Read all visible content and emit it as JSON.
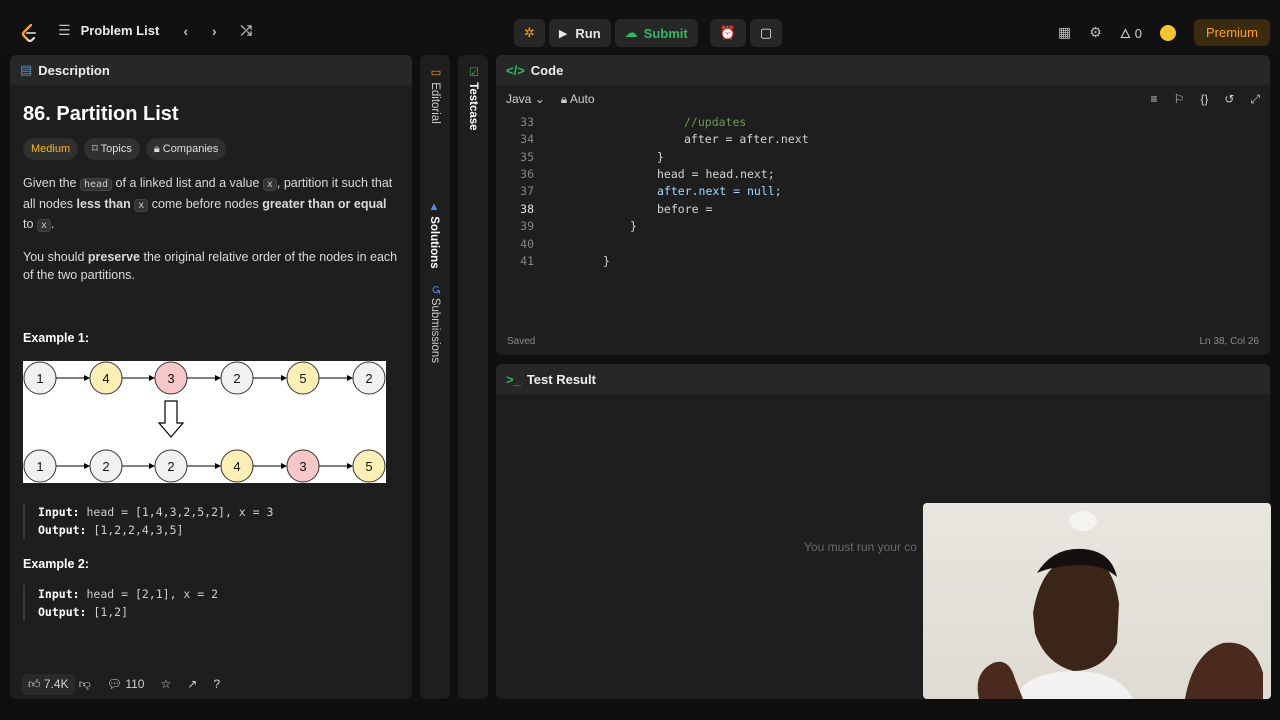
{
  "topbar": {
    "problem_list_label": "Problem List",
    "run_label": "Run",
    "submit_label": "Submit",
    "streak_count": "0",
    "premium_label": "Premium"
  },
  "description": {
    "header_label": "Description",
    "title": "86. Partition List",
    "chips": {
      "difficulty": "Medium",
      "topics": "Topics",
      "companies": "Companies"
    },
    "para1": {
      "t1": "Given the ",
      "c1": "head",
      "t2": " of a linked list and a value ",
      "c2": "x",
      "t3": ", partition it such that all nodes ",
      "b1": "less than",
      "t4": " ",
      "c3": "x",
      "t5": " come before nodes ",
      "b2": "greater than or equal",
      "t6": " to ",
      "c4": "x",
      "t7": "."
    },
    "para2": {
      "t1": "You should ",
      "b1": "preserve",
      "t2": " the original relative order of the nodes in each of the two partitions."
    },
    "example1": {
      "title": "Example 1:",
      "input_key": "Input:",
      "input_val": "head = [1,4,3,2,5,2], x = 3",
      "output_key": "Output:",
      "output_val": "[1,2,2,4,3,5]",
      "top_nodes": [
        "1",
        "4",
        "3",
        "2",
        "5",
        "2"
      ],
      "bottom_nodes": [
        "1",
        "2",
        "2",
        "4",
        "3",
        "5"
      ]
    },
    "example2": {
      "title": "Example 2:",
      "input_key": "Input:",
      "input_val": "head = [2,1], x = 2",
      "output_key": "Output:",
      "output_val": "[1,2]"
    },
    "footer": {
      "likes": "7.4K",
      "comments": "110"
    }
  },
  "side_tabs": {
    "editorial": "Editorial",
    "solutions": "Solutions",
    "submissions": "Submissions",
    "testcase": "Testcase"
  },
  "code": {
    "header_label": "Code",
    "language": "Java",
    "mode": "Auto",
    "lines": [
      {
        "n": "33",
        "text": "//updates"
      },
      {
        "n": "34",
        "text": "after = after.next"
      },
      {
        "n": "35",
        "text": "}"
      },
      {
        "n": "36",
        "text": "head = head.next;"
      },
      {
        "n": "37",
        "text": "after.next = null;"
      },
      {
        "n": "38",
        "text": "before = "
      },
      {
        "n": "39",
        "text": "}"
      },
      {
        "n": "40",
        "text": ""
      },
      {
        "n": "41",
        "text": "}"
      }
    ],
    "saved_label": "Saved",
    "cursor_pos": "Ln 38, Col 26"
  },
  "test_result": {
    "header_label": "Test Result",
    "message": "You must run your co"
  },
  "colors": {
    "accent": "#ffa116",
    "submit_green": "#2cbb5d",
    "medium_yellow": "#ffb800",
    "panel_bg": "#1e1e1e"
  }
}
